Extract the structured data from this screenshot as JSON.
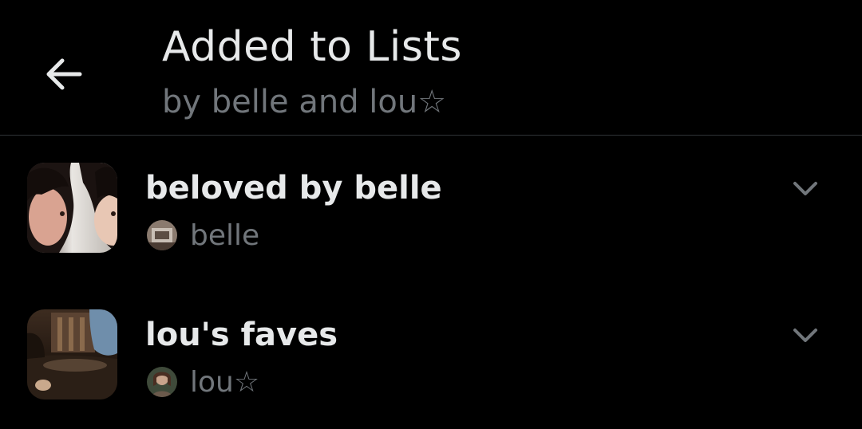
{
  "header": {
    "title": "Added to Lists",
    "subtitle": "by belle and lou☆"
  },
  "lists": [
    {
      "name": "beloved by belle",
      "owner": "belle",
      "thumbnail_icon": "list-cover-photo",
      "owner_avatar_icon": "user-avatar",
      "expand_icon": "chevron-down-icon"
    },
    {
      "name": "lou's faves",
      "owner": "lou☆",
      "thumbnail_icon": "list-cover-photo",
      "owner_avatar_icon": "user-avatar",
      "expand_icon": "chevron-down-icon"
    }
  ],
  "colors": {
    "background": "#000000",
    "primary_text": "#e7e9ea",
    "secondary_text": "#71767b",
    "divider": "#2f3336"
  }
}
